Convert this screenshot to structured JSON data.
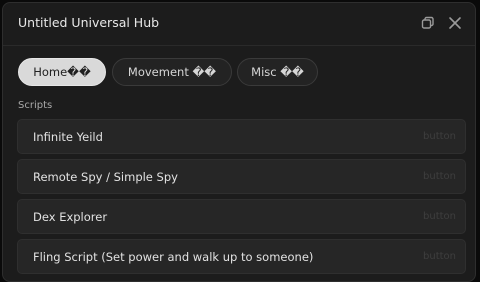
{
  "window": {
    "title": "Untitled Universal Hub"
  },
  "controls": {
    "restore_icon": "restore-icon",
    "close_icon": "close-icon"
  },
  "tabs": [
    {
      "label": "Home��",
      "active": true
    },
    {
      "label": "Movement ��",
      "active": false
    },
    {
      "label": "Misc ��",
      "active": false
    }
  ],
  "section": {
    "label": "Scripts"
  },
  "buttons": [
    {
      "label": "Infinite Yeild",
      "hint": "button"
    },
    {
      "label": "Remote Spy / Simple Spy",
      "hint": "button"
    },
    {
      "label": "Dex Explorer",
      "hint": "button"
    },
    {
      "label": "Fling Script (Set power and walk up to someone)",
      "hint": "button"
    }
  ],
  "colors": {
    "window_bg": "#1c1c1c",
    "row_bg": "#262626",
    "active_tab_bg": "#d9d9d9",
    "text": "#e2e2e2"
  }
}
